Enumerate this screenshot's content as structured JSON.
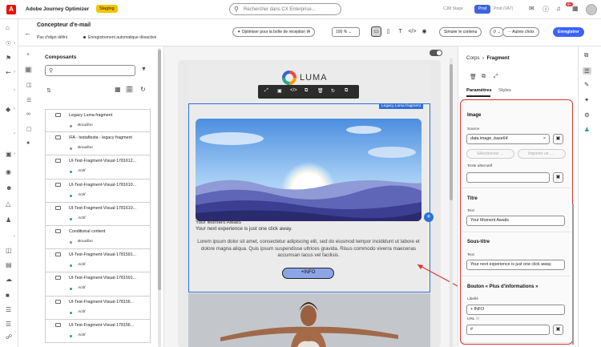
{
  "app": {
    "title": "Adobe Journey Optimizer",
    "env_badge": "Staging",
    "search_placeholder": "Rechercher dans CX Enterprise...",
    "org_name": "CJM Stage",
    "product_pill": "Prod",
    "user_name": "Prod (VA7)",
    "notif_count": "9+"
  },
  "header": {
    "title": "Concepteur d'e-mail",
    "subject": "Pas d'objet défini",
    "autosave": "Enregistrement automatique désactivé",
    "optimize_btn": "Optimiser pour la boîte de réception IA",
    "zoom": "100 %",
    "simulate_btn": "Simuler le contenu",
    "other_btn": "Autres choix",
    "save_btn": "Enregistrer"
  },
  "components": {
    "title": "Composants",
    "items": [
      {
        "name": "Legacy Luma fragment",
        "status": "Brouillon",
        "status_color": "#8a8a8a"
      },
      {
        "name": "IFA - testafiesta - legacy fragment",
        "status": "Brouillon",
        "status_color": "#8a8a8a"
      },
      {
        "name": "UI-Test-Fragment-Visual-1781612...",
        "status": "Actif",
        "status_color": "#2d9d78"
      },
      {
        "name": "UI-Test-Fragment-Visual-1781610...",
        "status": "Actif",
        "status_color": "#2d9d78"
      },
      {
        "name": "UI-Test-Fragment-Visual-1781610...",
        "status": "Actif",
        "status_color": "#2d9d78"
      },
      {
        "name": "Conditional content",
        "status": "Brouillon",
        "status_color": "#8a8a8a"
      },
      {
        "name": "UI-Test-Fragment-Visual-1781591...",
        "status": "Actif",
        "status_color": "#2d9d78"
      },
      {
        "name": "UI-Test-Fragment-Visual-1781591...",
        "status": "Actif",
        "status_color": "#2d9d78"
      },
      {
        "name": "UI-Test-Fragment-Visual-178156...",
        "status": "Actif",
        "status_color": "#2d9d78"
      },
      {
        "name": "UI-Test-Fragment-Visual-178156...",
        "status": "Actif",
        "status_color": "#2d9d78"
      }
    ]
  },
  "canvas": {
    "logo_text": "LUMA",
    "fragment_label": "Legacy Luma fragment",
    "title_text": "Your Moment Awaits",
    "subtitle_text": "Your next experience is just one click away.",
    "body_text": "Lorem ipsum dolor sit amet, consectetur adipiscing elit, sed do eiusmod tempor incididunt ut labore et dolore magna aliqua. Quis ipsum suspendisse ultrices gravida. Risus commodo viverra maecenas accumsan lacus vel facilisis.",
    "button_text": "+INFO"
  },
  "properties": {
    "breadcrumb_parent": "Corps",
    "breadcrumb_current": "Fragment",
    "tab_params": "Paramètres",
    "tab_styles": "Styles",
    "image": {
      "title": "Image",
      "source_label": "Source",
      "source_value": "data.image_base64",
      "select_btn": "Sélectionner ...",
      "import_btn": "Importer un ...",
      "alt_label": "Texte alternatif",
      "alt_value": ""
    },
    "titre": {
      "title": "Titre",
      "text_label": "Text",
      "text_value": "Your Moment Awaits"
    },
    "soustitre": {
      "title": "Sous-titre",
      "text_label": "Text",
      "text_value": "Your next experience is just one click away."
    },
    "bouton": {
      "title": "Bouton « Plus d'informations »",
      "label_label": "Libellé",
      "label_value": "+ INFO",
      "url_label": "URL",
      "url_value": "#"
    }
  }
}
